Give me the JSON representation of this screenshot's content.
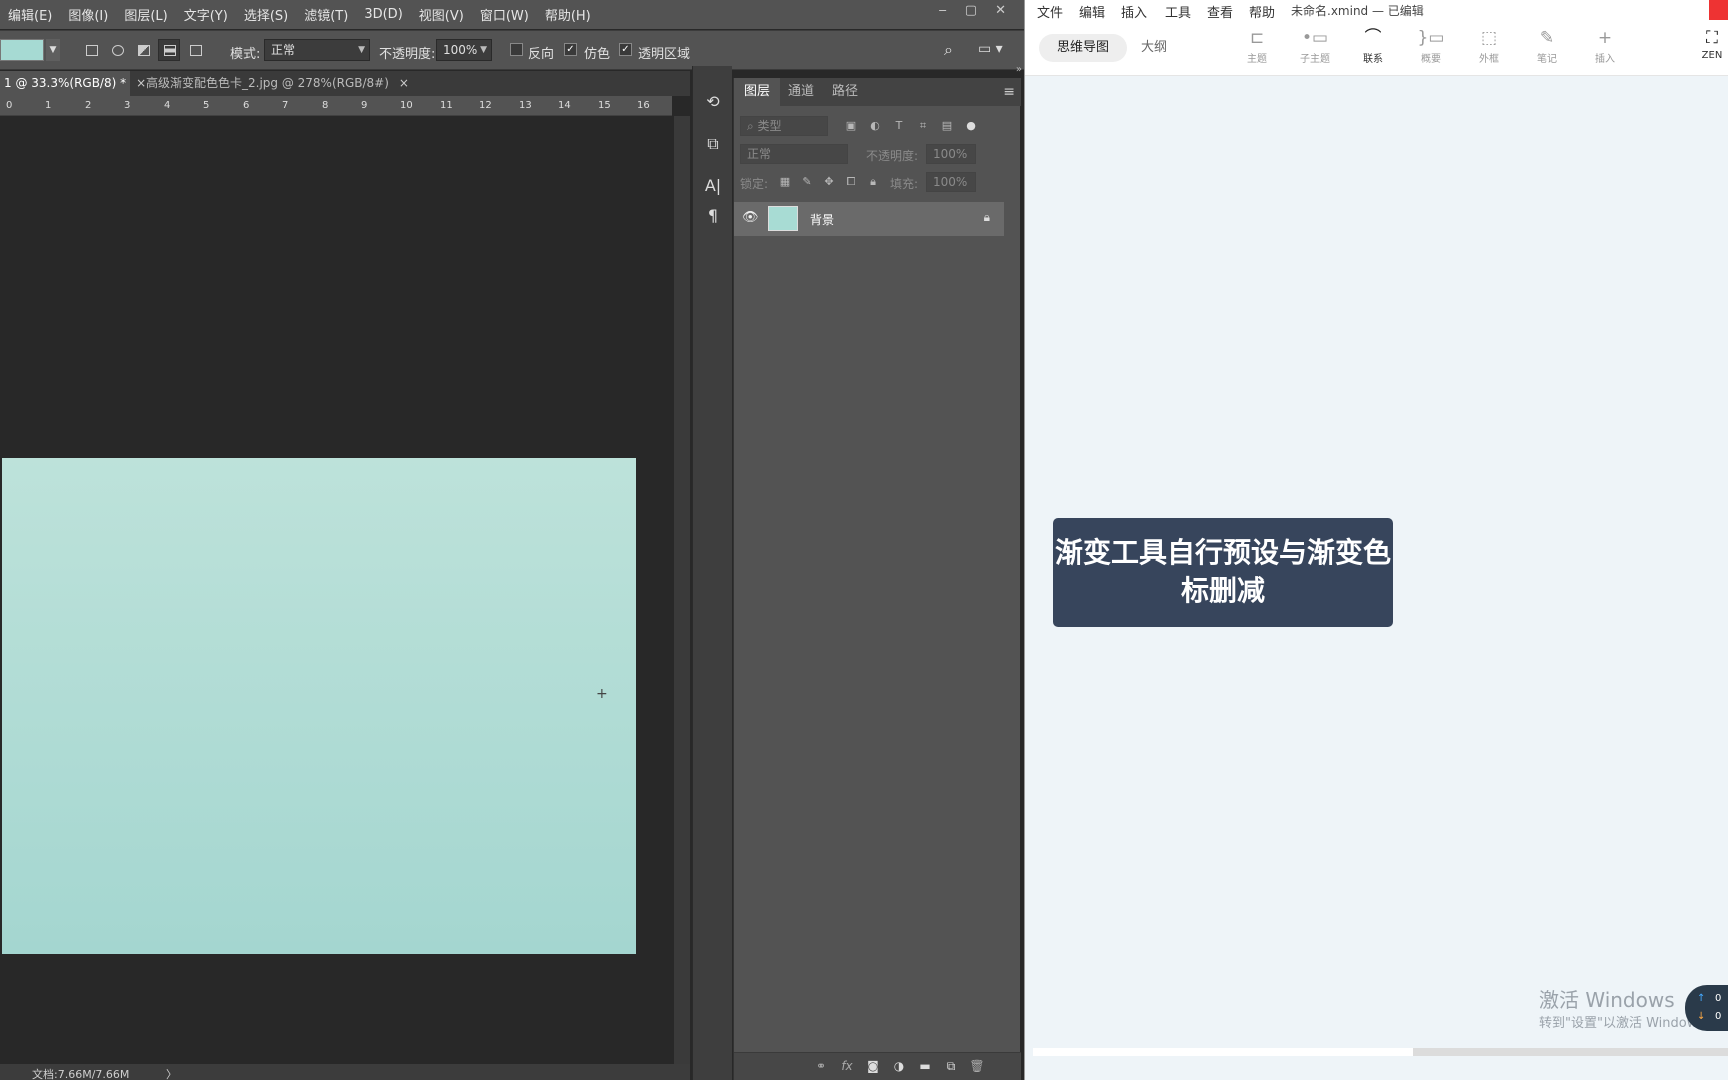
{
  "photoshop": {
    "menu": [
      "编辑(E)",
      "图像(I)",
      "图层(L)",
      "文字(Y)",
      "选择(S)",
      "滤镜(T)",
      "3D(D)",
      "视图(V)",
      "窗口(W)",
      "帮助(H)"
    ],
    "window_controls": [
      "‒",
      "▢",
      "✕"
    ],
    "options": {
      "foreground_color": "#a6dad3",
      "mode_label": "模式:",
      "mode_value": "正常",
      "opacity_label": "不透明度:",
      "opacity_value": "100%",
      "reverse_label": "反向",
      "reverse_checked": false,
      "dither_label": "仿色",
      "dither_checked": true,
      "transparency_label": "透明区域",
      "transparency_checked": true
    },
    "tabs": [
      {
        "label": "1 @ 33.3%(RGB/8) *",
        "close": "×",
        "active": true
      },
      {
        "label": "高级渐变配色色卡_2.jpg @ 278%(RGB/8#)",
        "close": "×",
        "active": false
      }
    ],
    "ruler_ticks": [
      "0",
      "1",
      "2",
      "3",
      "4",
      "5",
      "6",
      "7",
      "8",
      "9",
      "10",
      "11",
      "12",
      "13",
      "14",
      "15",
      "16"
    ],
    "status_text": "文档:7.66M/7.66M",
    "status_arrow": "〉",
    "canvas_gradient": [
      "#bde2da",
      "#a4d6d0"
    ],
    "layers_panel": {
      "tabs": [
        "图层",
        "通道",
        "路径"
      ],
      "filter_placeholder": "类型",
      "blend_mode": "正常",
      "opacity_label": "不透明度:",
      "opacity_value": "100%",
      "lock_label": "锁定:",
      "fill_label": "填充:",
      "fill_value": "100%",
      "layer_name": "背景"
    }
  },
  "xmind": {
    "menu": [
      "文件",
      "编辑",
      "插入",
      "工具",
      "查看",
      "帮助"
    ],
    "title": "未命名.xmind — 已编辑",
    "view_tabs": [
      "思维导图",
      "大纲"
    ],
    "toolbar": [
      {
        "icon": "topic-icon",
        "label": "主题",
        "active": false
      },
      {
        "icon": "subtopic-icon",
        "label": "子主题",
        "active": false
      },
      {
        "icon": "relationship-icon",
        "label": "联系",
        "active": true
      },
      {
        "icon": "summary-icon",
        "label": "概要",
        "active": false
      },
      {
        "icon": "boundary-icon",
        "label": "外框",
        "active": false
      },
      {
        "icon": "notes-icon",
        "label": "笔记",
        "active": false
      },
      {
        "icon": "insert-icon",
        "label": "插入",
        "active": false
      }
    ],
    "zen_label": "ZEN",
    "topic_text": "渐变工具自行预设与渐变色标删减",
    "topic_color": "#37455c",
    "watermark_line1": "激活 Windows",
    "watermark_line2": "转到\"设置\"以激活 Windows。",
    "net_up": "0",
    "net_down": "0"
  }
}
